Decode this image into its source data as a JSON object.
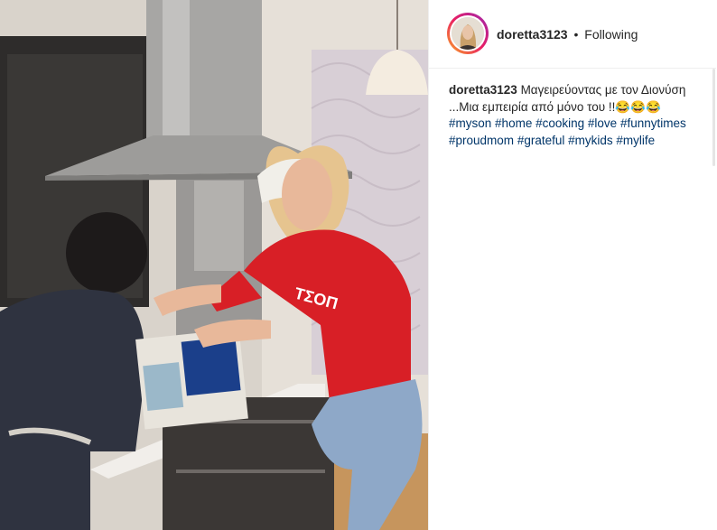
{
  "post": {
    "username": "doretta3123",
    "separator": "•",
    "follow_status": "Following",
    "caption_user": "doretta3123",
    "caption_text": "Μαγειρεύοντας με τον Διονύση ...Μια εμπειρία από μόνο του !!😂😂😂",
    "hashtags": [
      "#myson",
      "#home",
      "#cooking",
      "#love",
      "#funnytimes",
      "#proudmom",
      "#grateful",
      "#mykids",
      "#mylife"
    ]
  },
  "photo": {
    "description_icon": "photo",
    "shirt_text": "ΤΣΟΠ"
  },
  "colors": {
    "link": "#003569",
    "text": "#262626",
    "border": "#efefef",
    "sweater": "#d81f26"
  }
}
